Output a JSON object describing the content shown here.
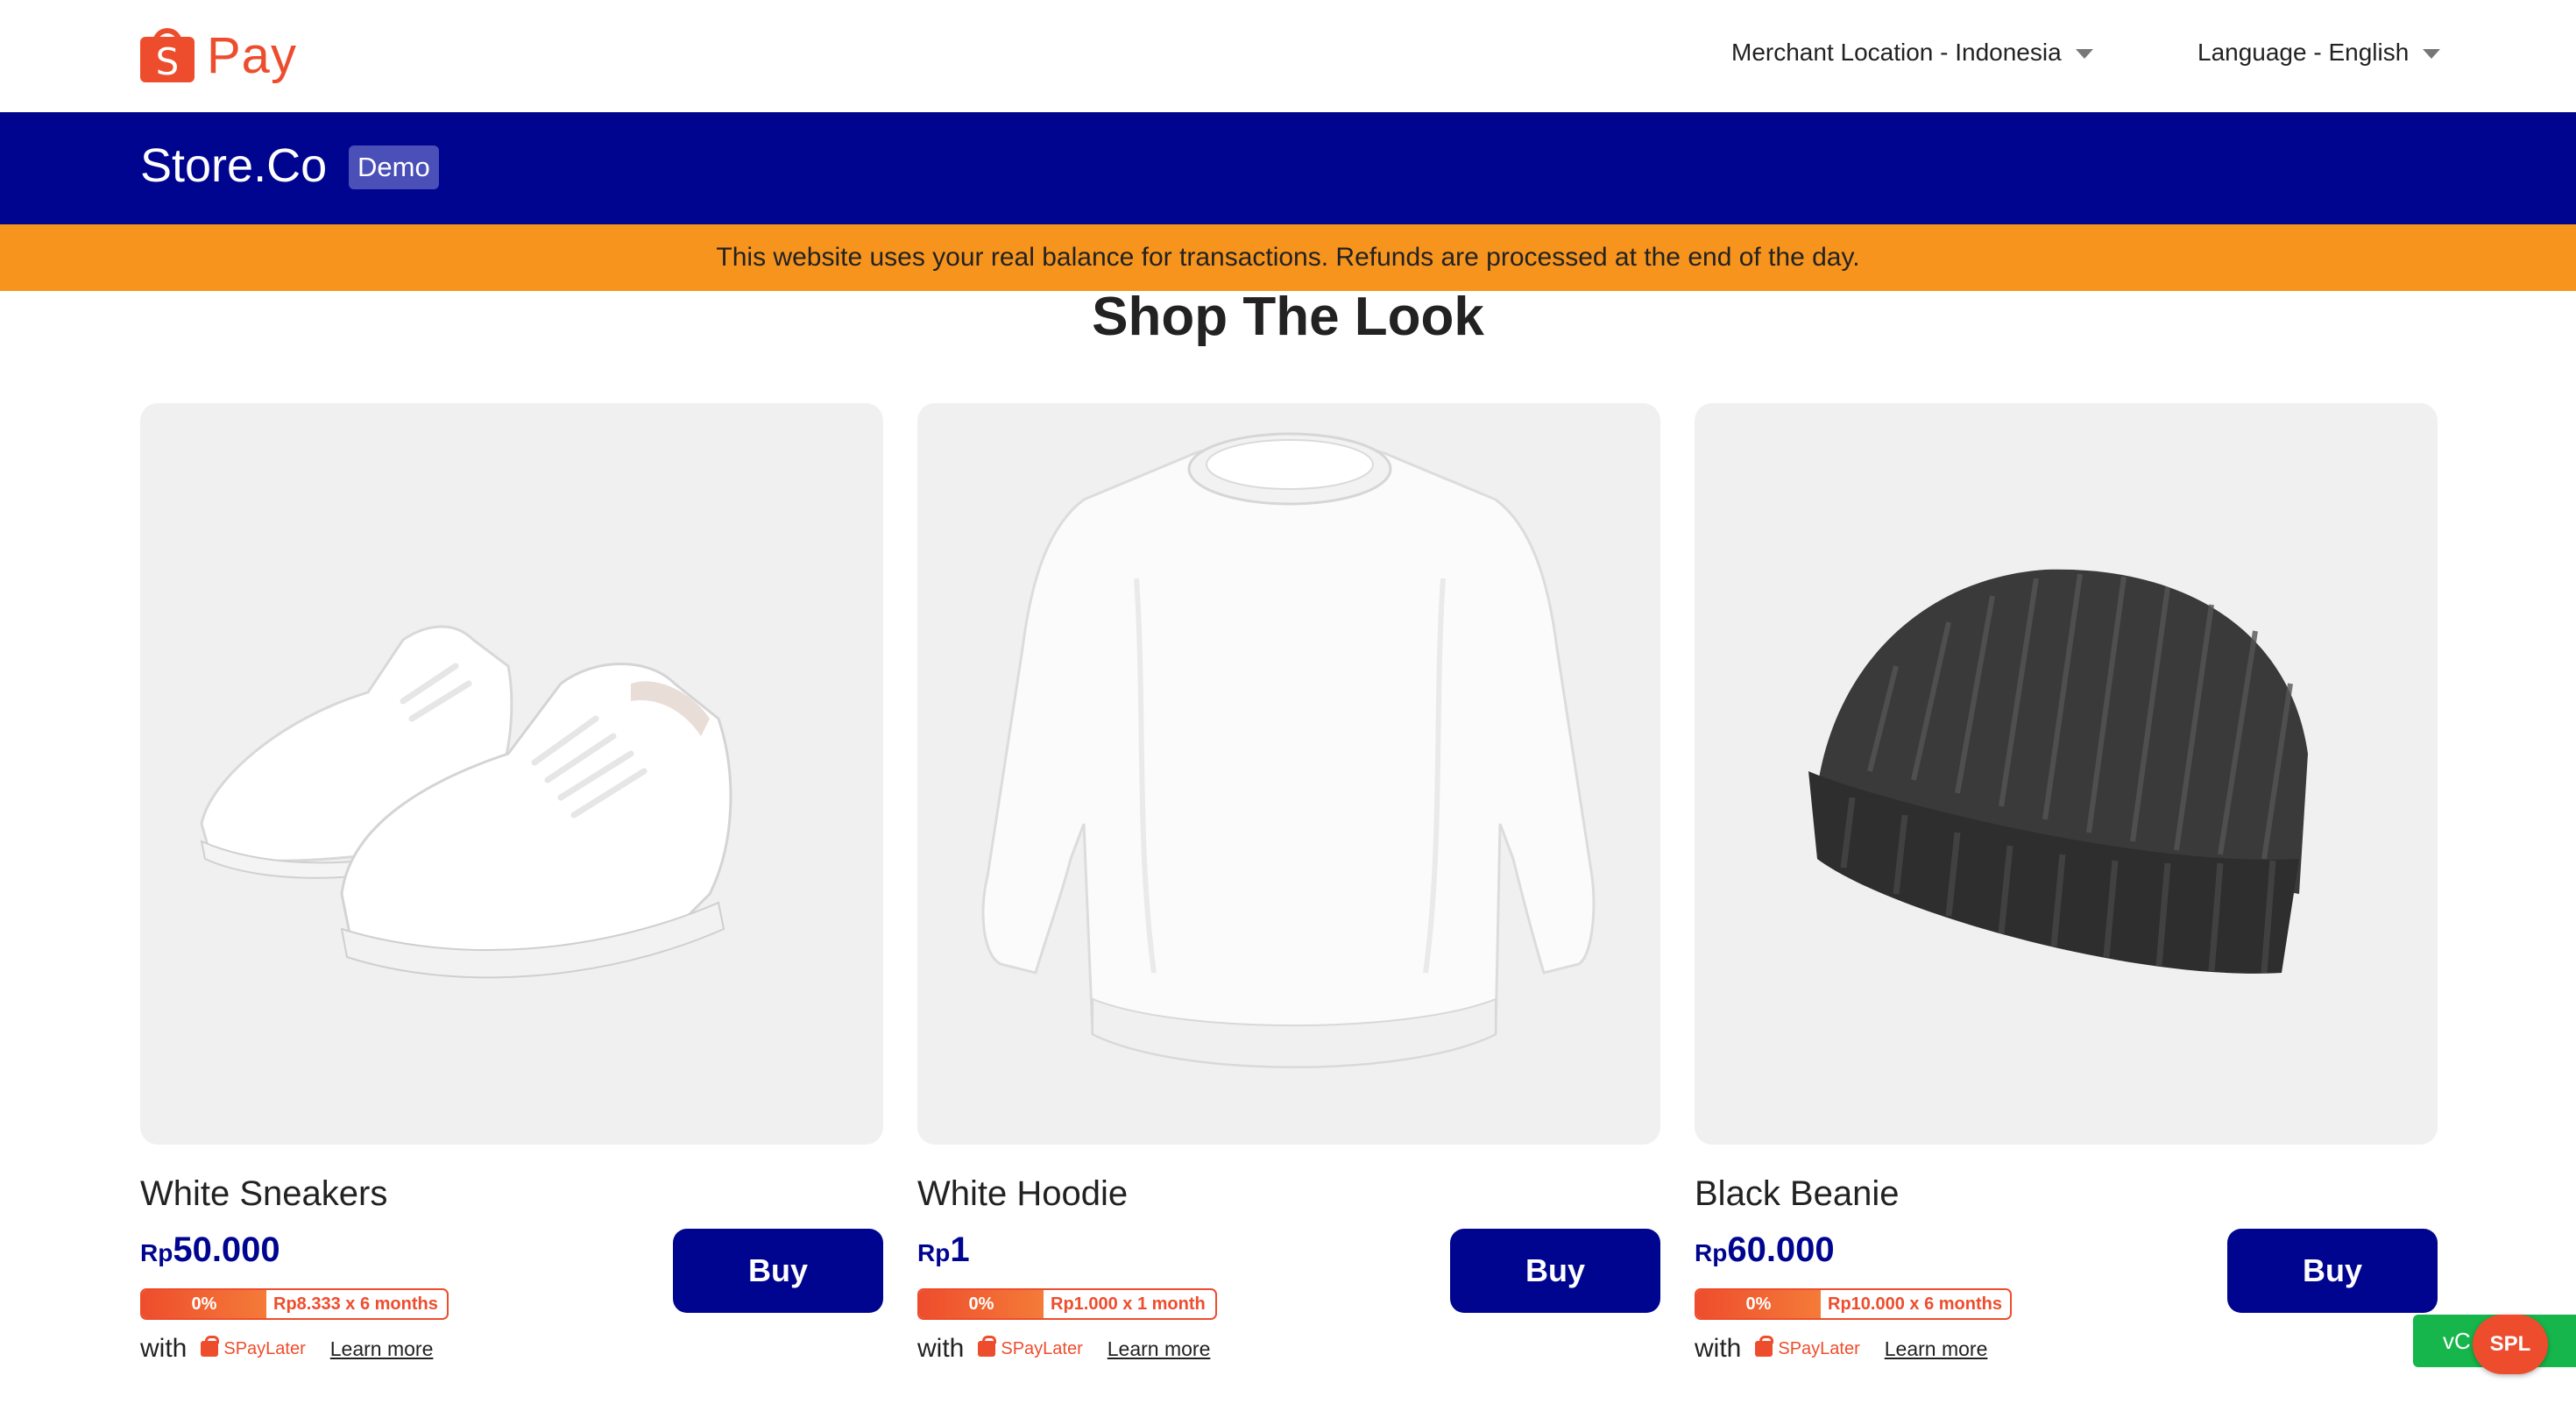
{
  "header": {
    "logo_letter": "S",
    "logo_text": "Pay",
    "merchant_location": "Merchant Location - Indonesia",
    "language": "Language - English"
  },
  "store": {
    "name": "Store.Co",
    "badge": "Demo"
  },
  "banner": {
    "text": "This website uses your real balance for transactions. Refunds are processed at the end of the day."
  },
  "section": {
    "title": "Shop The Look"
  },
  "products": [
    {
      "name": "White Sneakers",
      "currency": "Rp",
      "price": "50.000",
      "interest": "0%",
      "plan": "Rp8.333 x 6 months",
      "with_label": "with",
      "paylater": "SPayLater",
      "learn_more": "Learn more",
      "buy_label": "Buy"
    },
    {
      "name": "White Hoodie",
      "currency": "Rp",
      "price": "1",
      "interest": "0%",
      "plan": "Rp1.000 x 1 month",
      "with_label": "with",
      "paylater": "SPayLater",
      "learn_more": "Learn more",
      "buy_label": "Buy"
    },
    {
      "name": "Black Beanie",
      "currency": "Rp",
      "price": "60.000",
      "interest": "0%",
      "plan": "Rp10.000 x 6 months",
      "with_label": "with",
      "paylater": "SPayLater",
      "learn_more": "Learn more",
      "buy_label": "Buy"
    }
  ],
  "floating": {
    "vc_label": "vC",
    "spl_label": "SPL"
  },
  "colors": {
    "brand": "#ee4d2d",
    "navy": "#00058f",
    "banner": "#f7941d",
    "card_bg": "#f0f0f0",
    "green": "#16b64c"
  }
}
